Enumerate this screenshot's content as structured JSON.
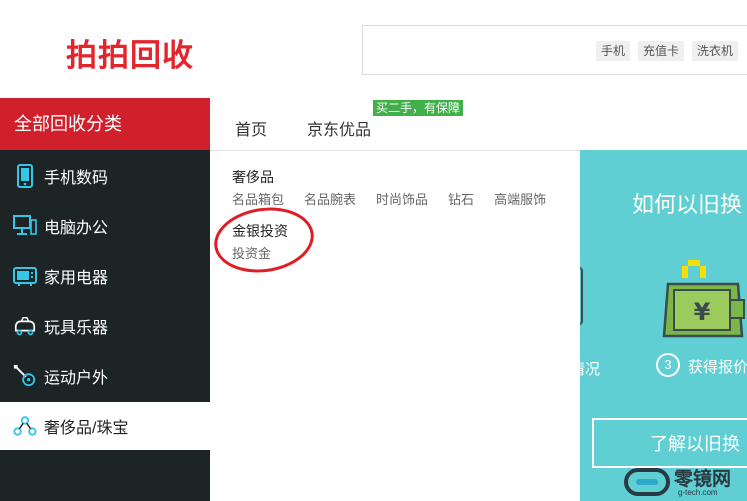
{
  "header": {
    "logo": "拍拍回收",
    "search": {
      "placeholder": "",
      "hot_words": [
        "手机",
        "充值卡",
        "洗衣机"
      ]
    }
  },
  "nav": {
    "all_categories": "全部回收分类",
    "links": [
      "首页",
      "京东优品"
    ],
    "badge": "买二手，有保障"
  },
  "sidebar": {
    "items": [
      {
        "label": "手机数码",
        "icon": "phone-icon"
      },
      {
        "label": "电脑办公",
        "icon": "computer-icon"
      },
      {
        "label": "家用电器",
        "icon": "tv-icon"
      },
      {
        "label": "玩具乐器",
        "icon": "toy-icon"
      },
      {
        "label": "运动户外",
        "icon": "guitar-icon"
      },
      {
        "label": "奢侈品/珠宝",
        "icon": "jewelry-icon",
        "active": true
      }
    ]
  },
  "dropdown": {
    "groups": [
      {
        "title": "奢侈品",
        "links": [
          "名品箱包",
          "名品腕表",
          "时尚饰品",
          "钻石",
          "高端服饰"
        ]
      },
      {
        "title": "金银投资",
        "links": [
          "投资金"
        ]
      }
    ]
  },
  "banner": {
    "title": "如何以旧换",
    "fragment": "情况",
    "step_number": "3",
    "step_label": "获得报价",
    "button": "了解以旧换"
  },
  "watermark": {
    "text": "零镜网",
    "sub": "g-tech.com"
  },
  "colors": {
    "brand_red": "#e3262d",
    "sidebar_bg": "#1d2426",
    "badge_green": "#41b04b",
    "banner_teal": "#5fcfd3",
    "icon_cyan": "#35c6e8"
  }
}
